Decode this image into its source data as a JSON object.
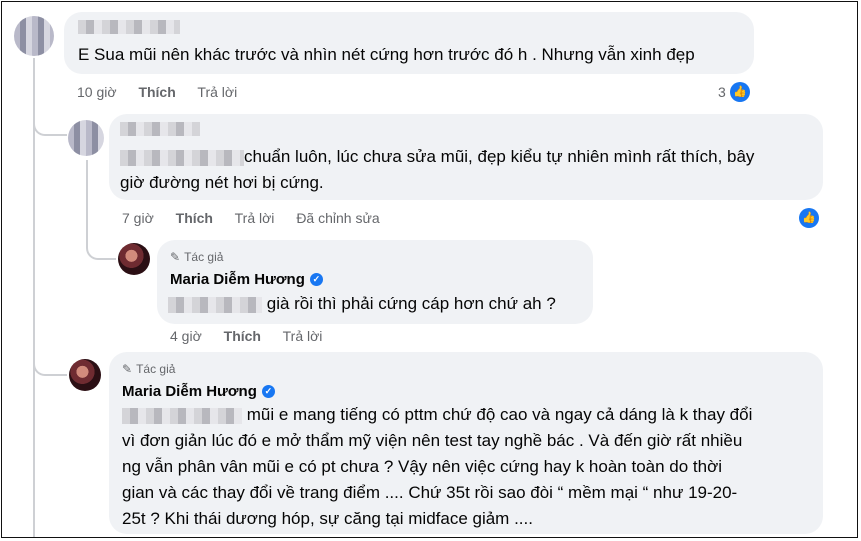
{
  "comments": [
    {
      "text": "E Sua mũi nên khác trước và nhìn nét cứng hơn trước đó h . Nhưng vẫn xinh đẹp",
      "time": "10 giờ",
      "like": "Thích",
      "reply": "Trả lời",
      "like_count": "3"
    },
    {
      "text_line1": "chuẩn luôn, lúc chưa sửa mũi, đẹp kiểu tự nhiên mình rất thích, bây",
      "text_line2": "giờ đường nét hơi bị cứng.",
      "time": "7 giờ",
      "like": "Thích",
      "reply": "Trả lời",
      "edited": "Đã chỉnh sửa"
    },
    {
      "author_tag": "Tác giả",
      "author": "Maria Diễm Hương",
      "text": "già rồi thì phải cứng cáp hơn chứ ah ?",
      "time": "4 giờ",
      "like": "Thích",
      "reply": "Trả lời"
    },
    {
      "author_tag": "Tác giả",
      "author": "Maria Diễm Hương",
      "lines": [
        "mũi e mang tiếng có pttm chứ độ cao và ngay cả dáng là k thay đổi",
        "vì đơn giản lúc đó e mở thẩm mỹ viện nên test tay nghề bác . Và đến giờ rất nhiều",
        "ng vẫn phân vân mũi e có pt chưa ? Vậy nên việc cứng hay k hoàn toàn do thời",
        "gian và các thay đổi về trang điểm .... Chứ 35t rồi sao đòi “ mềm mại “ như 19-20-",
        "25t ? Khi thái dương hóp, sự căng tại midface giảm ...."
      ]
    }
  ],
  "colors": {
    "accent": "#1877f2",
    "bubble": "#f0f2f5",
    "meta": "#65676b"
  }
}
